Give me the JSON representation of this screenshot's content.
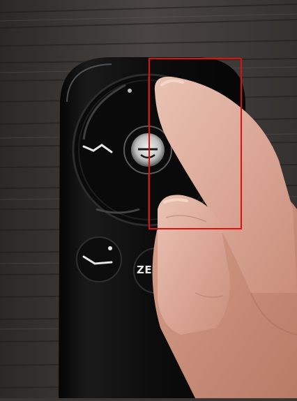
{
  "photo": {
    "subject": "adjustable-bed-remote-control",
    "zero_g_button_label": "ZE",
    "highlight_color": "#e01010"
  }
}
